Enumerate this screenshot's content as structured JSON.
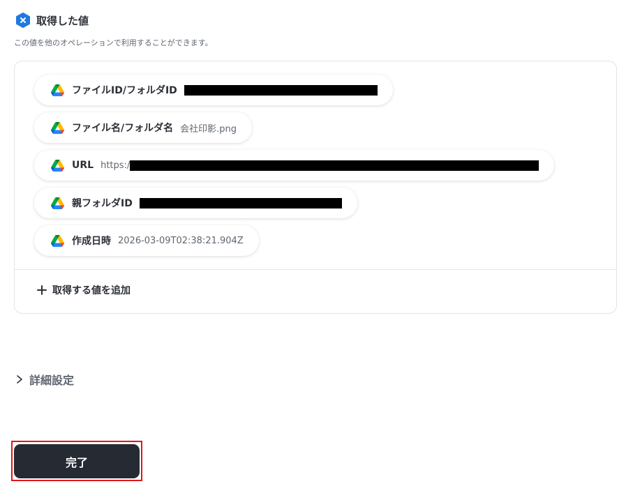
{
  "header": {
    "title": "取得した値",
    "description": "この値を他のオペレーションで利用することができます。",
    "icon": "yoom-x-badge-icon",
    "icon_color": "#1f7ae0"
  },
  "values": [
    {
      "label": "ファイルID/フォルダID",
      "value": "",
      "redacted": true,
      "icon": "google-drive-icon"
    },
    {
      "label": "ファイル名/フォルダ名",
      "value": "会社印影.png",
      "redacted": false,
      "icon": "google-drive-icon"
    },
    {
      "label": "URL",
      "value": "https:/",
      "redacted": true,
      "icon": "google-drive-icon"
    },
    {
      "label": "親フォルダID",
      "value": "",
      "redacted": true,
      "icon": "google-drive-icon"
    },
    {
      "label": "作成日時",
      "value": "2026-03-09T02:38:21.904Z",
      "redacted": false,
      "icon": "google-drive-icon"
    }
  ],
  "add_value_label": "取得する値を追加",
  "details": {
    "label": "詳細設定",
    "expanded": false
  },
  "done_button": {
    "label": "完了",
    "bg_color": "#252a33",
    "highlight_color": "#e0161b"
  }
}
